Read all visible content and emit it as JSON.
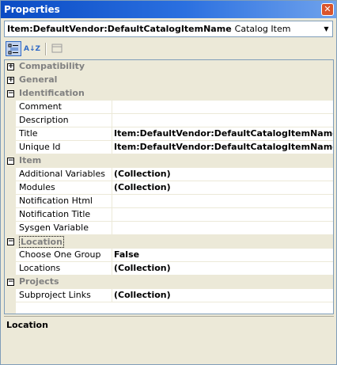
{
  "window": {
    "title": "Properties"
  },
  "object_selector": {
    "object_name": "Item:DefaultVendor:DefaultCatalogItemName",
    "object_type": "Catalog Item"
  },
  "toolbar": {
    "categorized_icon": "categorized-icon",
    "alphabetical_icon": "alphabetical-icon",
    "property_pages_icon": "property-pages-icon",
    "az_glyph": "A↓Z"
  },
  "grid": {
    "rows": [
      {
        "kind": "category",
        "expander": "+",
        "label": "Compatibility"
      },
      {
        "kind": "category",
        "expander": "+",
        "label": "General"
      },
      {
        "kind": "category",
        "expander": "−",
        "label": "Identification"
      },
      {
        "kind": "property",
        "name": "Comment",
        "value": ""
      },
      {
        "kind": "property",
        "name": "Description",
        "value": ""
      },
      {
        "kind": "property",
        "name": "Title",
        "value": "Item:DefaultVendor:DefaultCatalogItemName"
      },
      {
        "kind": "property",
        "name": "Unique Id",
        "value": "Item:DefaultVendor:DefaultCatalogItemName"
      },
      {
        "kind": "category",
        "expander": "−",
        "label": "Item"
      },
      {
        "kind": "property",
        "name": "Additional Variables",
        "value": "(Collection)"
      },
      {
        "kind": "property",
        "name": "Modules",
        "value": "(Collection)"
      },
      {
        "kind": "property",
        "name": "Notification Html",
        "value": ""
      },
      {
        "kind": "property",
        "name": "Notification Title",
        "value": ""
      },
      {
        "kind": "property",
        "name": "Sysgen Variable",
        "value": ""
      },
      {
        "kind": "category",
        "expander": "−",
        "label": "Location",
        "selected": true
      },
      {
        "kind": "property",
        "name": "Choose One Group",
        "value": "False"
      },
      {
        "kind": "property",
        "name": "Locations",
        "value": "(Collection)"
      },
      {
        "kind": "category",
        "expander": "−",
        "label": "Projects"
      },
      {
        "kind": "property",
        "name": "Subproject Links",
        "value": "(Collection)"
      },
      {
        "kind": "empty"
      }
    ]
  },
  "description_pane": {
    "title": "Location"
  }
}
